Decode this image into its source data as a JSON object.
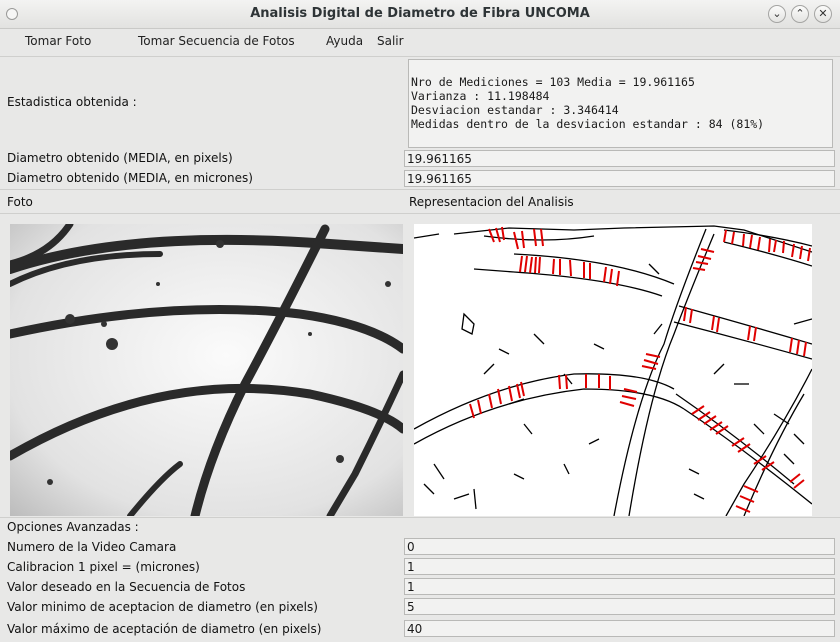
{
  "window": {
    "title": "Analisis Digital de Diametro de Fibra UNCOMA",
    "minimize_label": "⌄",
    "maximize_label": "⌃",
    "close_label": "✕"
  },
  "menu": [
    "Tomar Foto",
    "Tomar Secuencia de Fotos",
    "Ayuda",
    "Salir"
  ],
  "stats": {
    "label": "Estadistica obtenida :",
    "lines": [
      "Nro de Mediciones = 103 Media = 19.961165",
      "Varianza : 11.198484",
      "Desviacion estandar : 3.346414",
      "Medidas dentro de la desviacion estandar : 84 (81%)"
    ]
  },
  "diameter": {
    "pixels_label": "Diametro obtenido (MEDIA, en pixels)",
    "pixels_value": "19.961165",
    "microns_label": "Diametro obtenido (MEDIA, en micrones)",
    "microns_value": "19.961165"
  },
  "images": {
    "photo_label": "Foto",
    "analysis_label": "Representacion del Analisis"
  },
  "advanced": {
    "heading": "Opciones Avanzadas :",
    "options": [
      {
        "label": "Numero de la Video Camara",
        "value": "0"
      },
      {
        "label": "Calibracion 1 pixel = (micrones)",
        "value": "1"
      },
      {
        "label": "Valor deseado en la Secuencia de Fotos",
        "value": "1"
      },
      {
        "label": "Valor minimo de aceptacion de diametro (en pixels)",
        "value": "5"
      },
      {
        "label": "Valor máximo de aceptación de diametro (en pixels)",
        "value": "40"
      }
    ]
  },
  "colors": {
    "fiber": "#2a2a2a",
    "measure": "#e00000",
    "edge": "#000000"
  }
}
